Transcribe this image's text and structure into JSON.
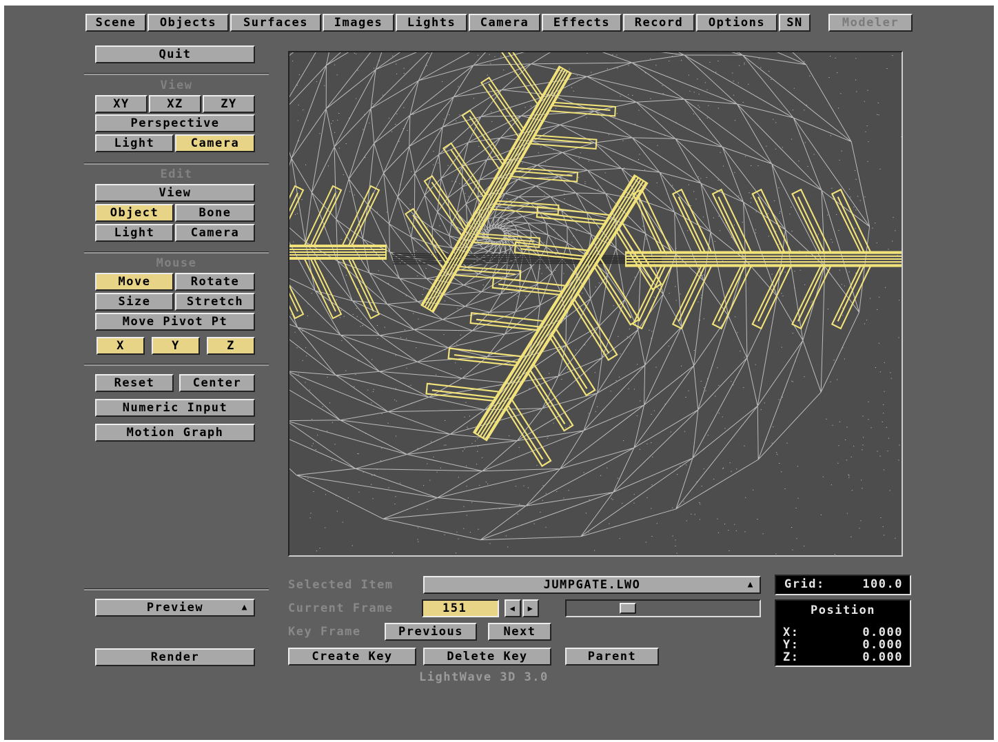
{
  "menu": {
    "tabs": [
      "Scene",
      "Objects",
      "Surfaces",
      "Images",
      "Lights",
      "Camera",
      "Effects",
      "Record",
      "Options",
      "SN"
    ],
    "modeler": "Modeler"
  },
  "left": {
    "quit": "Quit",
    "view_title": "View",
    "xy": "XY",
    "xz": "XZ",
    "zy": "ZY",
    "perspective": "Perspective",
    "light": "Light",
    "camera": "Camera",
    "edit_title": "Edit",
    "edit_view": "View",
    "object": "Object",
    "bone": "Bone",
    "edit_light": "Light",
    "edit_camera": "Camera",
    "mouse_title": "Mouse",
    "move": "Move",
    "rotate": "Rotate",
    "size": "Size",
    "stretch": "Stretch",
    "move_pivot": "Move Pivot Pt",
    "x": "X",
    "y": "Y",
    "z": "Z",
    "reset": "Reset",
    "center": "Center",
    "numeric": "Numeric Input",
    "motion_graph": "Motion Graph",
    "preview": "Preview",
    "render": "Render"
  },
  "bottom": {
    "selected_label": "Selected Item",
    "selected_value": "JUMPGATE.LWO",
    "current_label": "Current Frame",
    "current_value": "151",
    "keyframe_label": "Key Frame",
    "previous": "Previous",
    "next": "Next",
    "create_key": "Create Key",
    "delete_key": "Delete Key",
    "parent": "Parent",
    "version": "LightWave 3D 3.0",
    "frame_slider_fraction": 0.3
  },
  "info": {
    "grid_label": "Grid:",
    "grid_value": "100.0",
    "position_title": "Position",
    "x_label": "X:",
    "x_value": "0.000",
    "y_label": "Y:",
    "y_value": "0.000",
    "z_label": "Z:",
    "z_value": "0.000"
  },
  "colors": {
    "background": "#5f5f5f",
    "button": "#a8a8a8",
    "active": "#e8d486",
    "wire_yellow": "#f2e27a",
    "wire_grey": "#bcbcbc"
  }
}
